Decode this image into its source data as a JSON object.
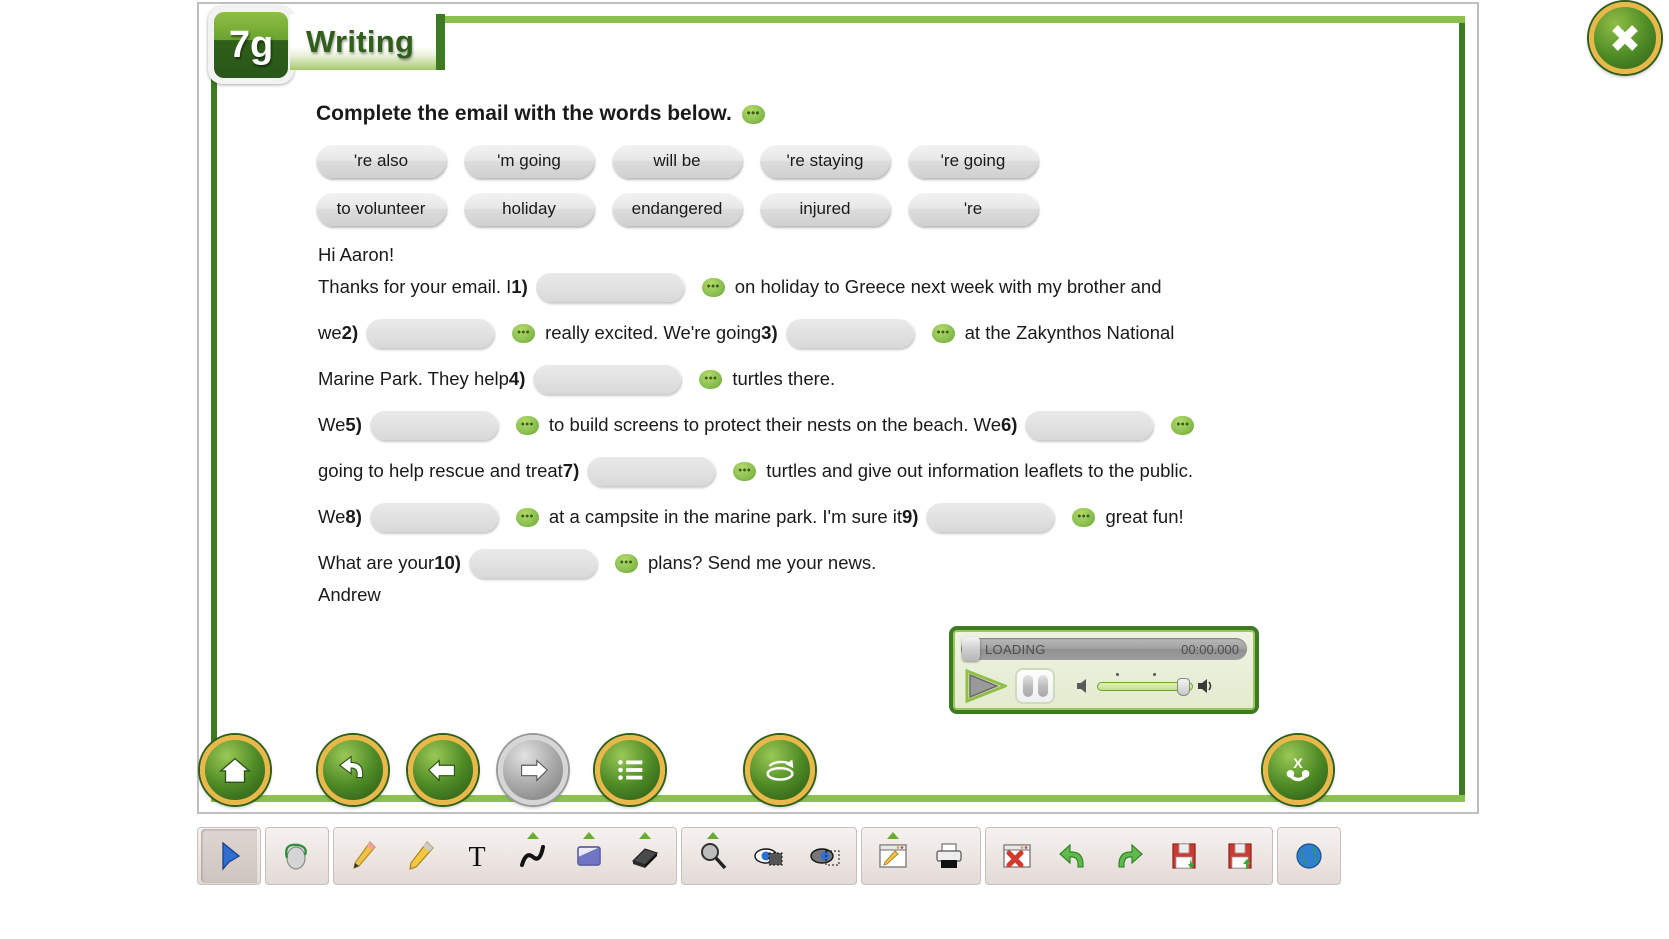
{
  "header": {
    "unit_badge": "7g",
    "title": "Writing",
    "close_label": "close-window"
  },
  "instruction": {
    "text": "Complete the email with the words below.",
    "audio_icon": "speech-bubble-icon"
  },
  "wordbank": {
    "rows": [
      [
        "'re also",
        "'m going",
        "will be",
        "'re staying",
        "'re going"
      ],
      [
        "to volunteer",
        "holiday",
        "endangered",
        "injured",
        "'re"
      ]
    ]
  },
  "email": {
    "greeting": "Hi Aaron!",
    "signature": "Andrew",
    "lines": [
      {
        "before": "Thanks for your email. I ",
        "num": "1)",
        "after": "on holiday to Greece next week with my brother and"
      },
      {
        "before": "we ",
        "num": "2)",
        "mid": "really excited. We're going ",
        "num2": "3)",
        "after": "at the Zakynthos National"
      },
      {
        "before": "Marine Park. They help ",
        "num": "4)",
        "after": "turtles there."
      },
      {
        "before": "We ",
        "num": "5)",
        "after": "to build screens to protect their nests on the beach. We ",
        "num2": "6)",
        "after2": ""
      },
      {
        "before": "going to help rescue and treat ",
        "num": "7)",
        "after": "turtles and give out information leaflets to the public."
      },
      {
        "before": "We ",
        "num": "8)",
        "mid": "at a campsite in the marine park. I'm sure it ",
        "num2": "9)",
        "after": "great fun!"
      },
      {
        "before": "What are your ",
        "num": "10)",
        "after": "plans? Send me your news."
      }
    ]
  },
  "player": {
    "status": "LOADING",
    "time": "00:00.000",
    "play_label": "play-button",
    "pause_label": "pause-button",
    "volume_label": "volume-slider"
  },
  "nav": {
    "buttons": [
      {
        "name": "home-button",
        "icon": "home-icon",
        "disabled": false
      },
      {
        "name": "undo-button",
        "icon": "undo-arrow-icon",
        "disabled": false
      },
      {
        "name": "previous-button",
        "icon": "left-arrow-icon",
        "disabled": false
      },
      {
        "name": "next-button",
        "icon": "right-arrow-icon",
        "disabled": true
      },
      {
        "name": "contents-button",
        "icon": "list-icon",
        "disabled": false
      },
      {
        "name": "reset-button",
        "icon": "refresh-icon",
        "disabled": false
      },
      {
        "name": "check-answers-button",
        "icon": "check-answers-icon",
        "disabled": false
      }
    ]
  },
  "toolbar": {
    "groups": [
      {
        "items": [
          {
            "name": "select-tool",
            "icon": "cursor-arrow-icon",
            "selected": true
          }
        ]
      },
      {
        "items": [
          {
            "name": "mouse-tool",
            "icon": "mouse-icon",
            "caret": false
          }
        ]
      },
      {
        "items": [
          {
            "name": "pen-tool",
            "icon": "pencil-icon",
            "caret": false
          },
          {
            "name": "highlighter-tool",
            "icon": "marker-pen-icon",
            "caret": false
          },
          {
            "name": "text-tool",
            "icon": "text-t-icon",
            "caret": false
          },
          {
            "name": "line-tool",
            "icon": "curve-line-icon",
            "caret": true
          },
          {
            "name": "shape-tool",
            "icon": "square-shape-icon",
            "caret": true
          },
          {
            "name": "eraser-tool",
            "icon": "eraser-icon",
            "caret": true
          }
        ]
      },
      {
        "items": [
          {
            "name": "zoom-tool",
            "icon": "magnifier-icon",
            "caret": true
          },
          {
            "name": "hide-tool",
            "icon": "eye-hide-icon",
            "caret": false
          },
          {
            "name": "reveal-tool",
            "icon": "eye-reveal-icon",
            "caret": false
          }
        ]
      },
      {
        "items": [
          {
            "name": "annotate-page-button",
            "icon": "window-pencil-icon",
            "caret": true
          },
          {
            "name": "print-button",
            "icon": "printer-icon",
            "caret": false
          }
        ]
      },
      {
        "items": [
          {
            "name": "clear-annotations-button",
            "icon": "window-delete-icon",
            "caret": false
          },
          {
            "name": "undo-annotation-button",
            "icon": "undo-green-arrow-icon",
            "caret": false
          },
          {
            "name": "redo-annotation-button",
            "icon": "redo-green-arrow-icon",
            "caret": false
          },
          {
            "name": "save-button",
            "icon": "floppy-save-icon",
            "caret": false
          },
          {
            "name": "save-as-button",
            "icon": "floppy-save-as-icon",
            "caret": false
          }
        ]
      },
      {
        "items": [
          {
            "name": "web-links-button",
            "icon": "globe-icon",
            "caret": false
          }
        ]
      }
    ]
  },
  "colors": {
    "green_dark": "#3d7a22",
    "green_light": "#8cc152",
    "gold": "#e8b84b",
    "chip_grey": "#e2e2e2"
  }
}
